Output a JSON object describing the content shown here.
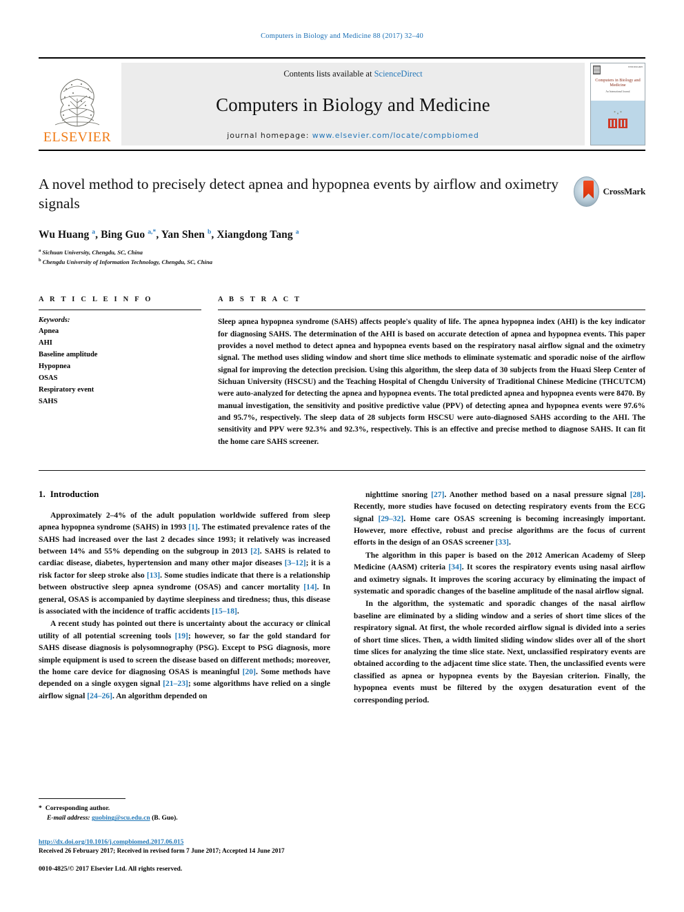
{
  "running_head": "Computers in Biology and Medicine 88 (2017) 32–40",
  "masthead": {
    "contents_prefix": "Contents lists available at ",
    "contents_link": "ScienceDirect",
    "journal_title": "Computers in Biology and Medicine",
    "homepage_prefix": "journal homepage: ",
    "homepage_link": "www.elsevier.com/locate/compbiomed",
    "publisher_logo_text": "ELSEVIER",
    "cover": {
      "title": "Computers in Biology and Medicine",
      "subtitle": "An International Journal",
      "barcode": "ISSN 0010-4825"
    }
  },
  "article": {
    "title": "A novel method to precisely detect apnea and hypopnea events by airflow and oximetry signals",
    "crossmark_label": "CrossMark",
    "authors_html": "Wu Huang <sup>a</sup>, Bing Guo <sup>a,*</sup>, Yan Shen <sup>b</sup>, Xiangdong Tang <sup>a</sup>",
    "affiliations": [
      {
        "marker": "a",
        "text": "Sichuan University, Chengdu, SC, China"
      },
      {
        "marker": "b",
        "text": "Chengdu University of Information Technology, Chengdu, SC, China"
      }
    ]
  },
  "article_info": {
    "heading": "A R T I C L E  I N F O",
    "keywords_label": "Keywords:",
    "keywords": [
      "Apnea",
      "AHI",
      "Baseline amplitude",
      "Hypopnea",
      "OSAS",
      "Respiratory event",
      "SAHS"
    ]
  },
  "abstract": {
    "heading": "A B S T R A C T",
    "text": "Sleep apnea hypopnea syndrome (SAHS) affects people's quality of life. The apnea hypopnea index (AHI) is the key indicator for diagnosing SAHS. The determination of the AHI is based on accurate detection of apnea and hypopnea events. This paper provides a novel method to detect apnea and hypopnea events based on the respiratory nasal airflow signal and the oximetry signal. The method uses sliding window and short time slice methods to eliminate systematic and sporadic noise of the airflow signal for improving the detection precision. Using this algorithm, the sleep data of 30 subjects from the Huaxi Sleep Center of Sichuan University (HSCSU) and the Teaching Hospital of Chengdu University of Traditional Chinese Medicine (THCUTCM) were auto-analyzed for detecting the apnea and hypopnea events. The total predicted apnea and hypopnea events were 8470. By manual investigation, the sensitivity and positive predictive value (PPV) of detecting apnea and hypopnea events were 97.6% and 95.7%, respectively. The sleep data of 28 subjects form HSCSU were auto-diagnosed SAHS according to the AHI. The sensitivity and PPV were 92.3% and 92.3%, respectively. This is an effective and precise method to diagnose SAHS. It can fit the home care SAHS screener."
  },
  "introduction": {
    "number": "1.",
    "title": "Introduction",
    "left_paragraphs": [
      "Approximately 2–4% of the adult population worldwide suffered from sleep apnea hypopnea syndrome (SAHS) in 1993 [1]. The estimated prevalence rates of the SAHS had increased over the last 2 decades since 1993; it relatively was increased between 14% and 55% depending on the subgroup in 2013 [2]. SAHS is related to cardiac disease, diabetes, hypertension and many other major diseases [3–12]; it is a risk factor for sleep stroke also [13]. Some studies indicate that there is a relationship between obstructive sleep apnea syndrome (OSAS) and cancer mortality [14]. In general, OSAS is accompanied by daytime sleepiness and tiredness; thus, this disease is associated with the incidence of traffic accidents [15–18].",
      "A recent study has pointed out there is uncertainty about the accuracy or clinical utility of all potential screening tools [19]; however, so far the gold standard for SAHS disease diagnosis is polysomnography (PSG). Except to PSG diagnosis, more simple equipment is used to screen the disease based on different methods; moreover, the home care device for diagnosing OSAS is meaningful [20]. Some methods have depended on a single oxygen signal [21–23]; some algorithms have relied on a single airflow signal [24–26]. An algorithm depended on"
    ],
    "right_paragraphs": [
      "nighttime snoring [27]. Another method based on a nasal pressure signal [28]. Recently, more studies have focused on detecting respiratory events from the ECG signal [29–32]. Home care OSAS screening is becoming increasingly important. However, more effective, robust and precise algorithms are the focus of current efforts in the design of an OSAS screener [33].",
      "The algorithm in this paper is based on the 2012 American Academy of Sleep Medicine (AASM) criteria [34]. It scores the respiratory events using nasal airflow and oximetry signals. It improves the scoring accuracy by eliminating the impact of systematic and sporadic changes of the baseline amplitude of the nasal airflow signal.",
      "In the algorithm, the systematic and sporadic changes of the nasal airflow baseline are eliminated by a sliding window and a series of short time slices of the respiratory signal. At first, the whole recorded airflow signal is divided into a series of short time slices. Then, a width limited sliding window slides over all of the short time slices for analyzing the time slice state. Next, unclassified respiratory events are obtained according to the adjacent time slice state. Then, the unclassified events were classified as apnea or hypopnea events by the Bayesian criterion. Finally, the hypopnea events must be filtered by the oxygen desaturation event of the corresponding period."
    ]
  },
  "footer": {
    "corresponding_star": "*",
    "corresponding_text": "Corresponding author.",
    "email_label": "E-mail address:",
    "email": "guobing@scu.edu.cn",
    "email_suffix": "(B. Guo).",
    "doi": "http://dx.doi.org/10.1016/j.compbiomed.2017.06.015",
    "received": "Received 26 February 2017; Received in revised form 7 June 2017; Accepted 14 June 2017",
    "copyright": "0010-4825/© 2017 Elsevier Ltd. All rights reserved."
  },
  "colors": {
    "link_blue": "#2479b7",
    "elsevier_orange": "#F07C18",
    "masthead_grey": "#ececec"
  }
}
